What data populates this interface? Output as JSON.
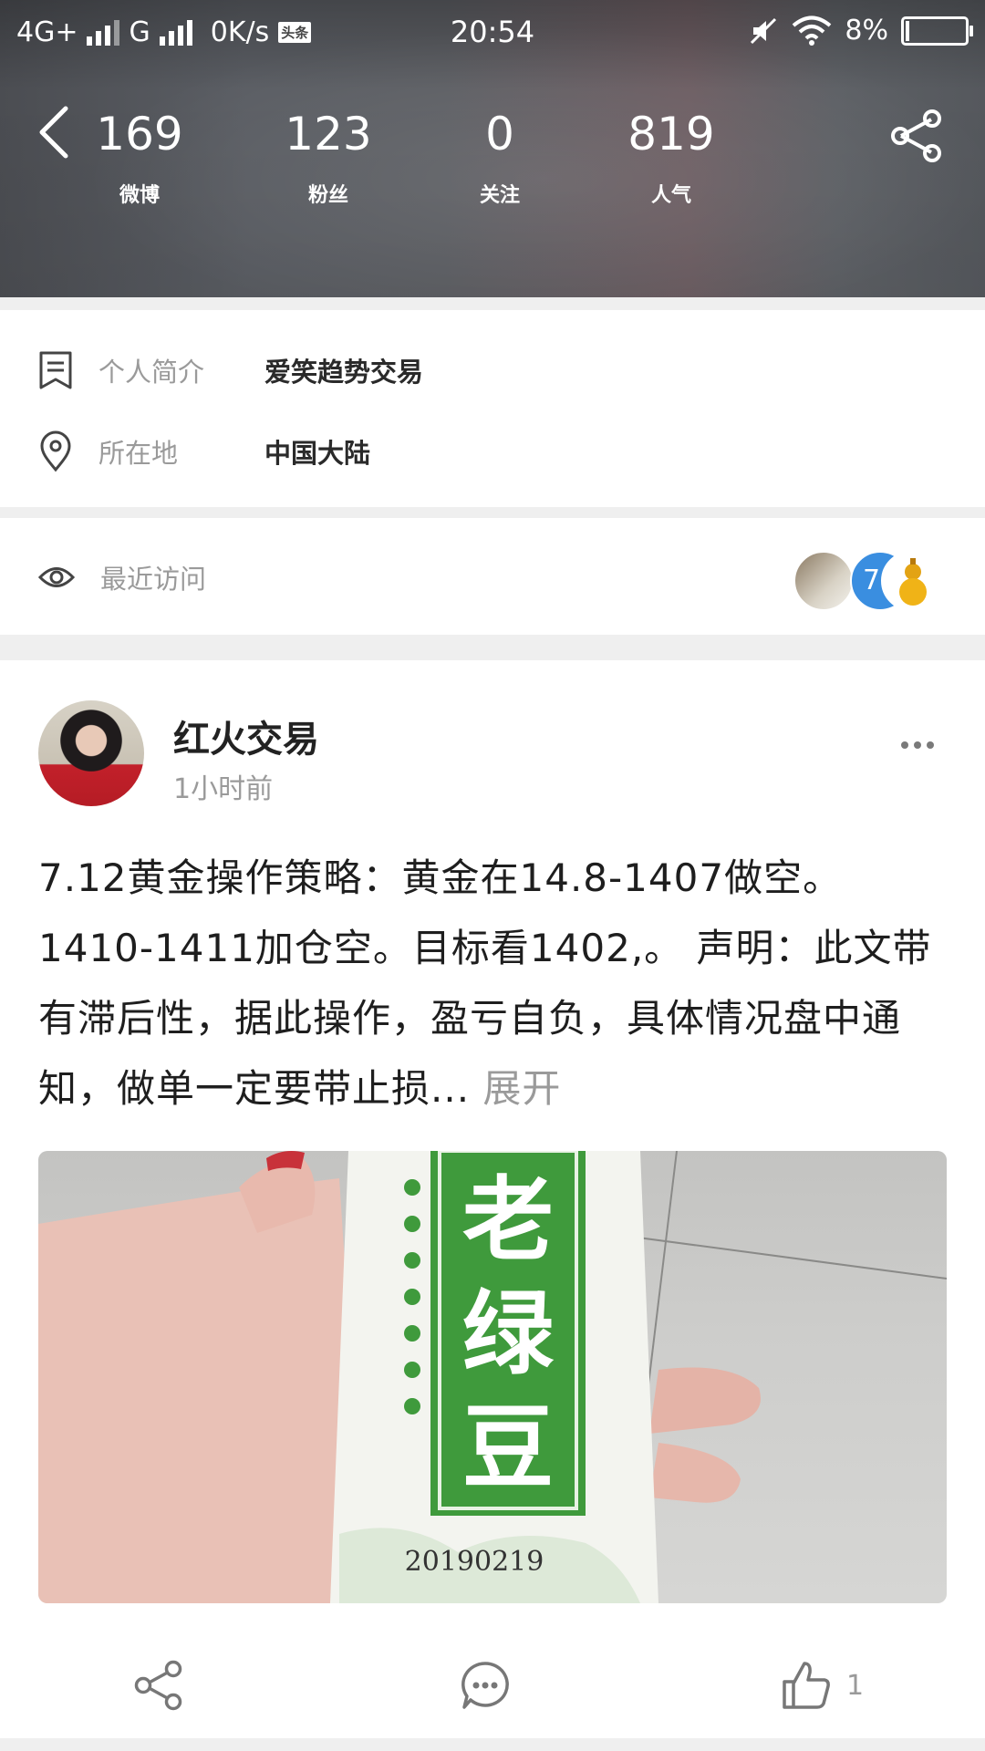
{
  "status_bar": {
    "network1": "4G+",
    "network2": "G",
    "speed": "0K/s",
    "news_badge": "头条",
    "time": "20:54",
    "battery": "8%",
    "battery_level": 0.08,
    "icons": [
      "signal-icon",
      "mute-icon",
      "wifi-icon",
      "battery-icon"
    ]
  },
  "profile_header": {
    "back_icon": "back-arrow-icon",
    "share_icon": "share-icon",
    "stats": [
      {
        "value": "169",
        "label": "微博"
      },
      {
        "value": "123",
        "label": "粉丝"
      },
      {
        "value": "0",
        "label": "关注"
      },
      {
        "value": "819",
        "label": "人气"
      }
    ]
  },
  "profile_info": {
    "bio_label": "个人简介",
    "bio_value": "爱笑趋势交易",
    "location_label": "所在地",
    "location_value": "中国大陆"
  },
  "recent_visits": {
    "label": "最近访问",
    "count_badge": "7"
  },
  "post": {
    "author": "红火交易",
    "time": "1小时前",
    "text": "7.12黄金操作策略：黄金在14.8-1407做空。1410-1411加仓空。目标看1402,。 声明：此文带有滞后性，据此操作，盈亏自负，具体情况盘中通知，做单一定要带止损...",
    "expand_label": "展开",
    "image": {
      "package_line1": "老",
      "package_line2": "绿",
      "package_line3": "豆",
      "package_code": "20190219"
    },
    "actions": {
      "share_icon": "share-icon",
      "comment_icon": "comment-icon",
      "like_icon": "thumbs-up-icon",
      "like_count": "1"
    }
  },
  "colors": {
    "header_bg": "#55585d",
    "label_gray": "#9a9a9a",
    "text_dark": "#1e1e1e",
    "package_green": "#3f9a3c",
    "badge_blue": "#3a8ee0"
  }
}
